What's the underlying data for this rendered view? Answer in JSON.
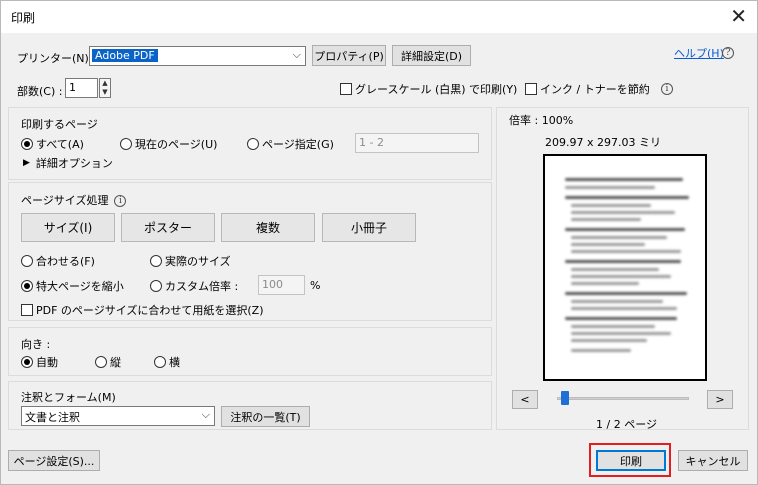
{
  "window": {
    "title": "印刷"
  },
  "printer": {
    "label": "プリンター(N) :",
    "selected": "Adobe PDF",
    "properties_button": "プロパティ(P)",
    "advanced_button": "詳細設定(D)",
    "help_link": "ヘルプ(H)"
  },
  "copies": {
    "label": "部数(C) :",
    "value": "1"
  },
  "options": {
    "grayscale": "グレースケール (白黒) で印刷(Y)",
    "save_ink": "インク / トナーを節約"
  },
  "pages_section": {
    "heading": "印刷するページ",
    "all": "すべて(A)",
    "current": "現在のページ(U)",
    "range": "ページ指定(G)",
    "range_value": "1 - 2",
    "more_options": "詳細オプション"
  },
  "page_sizing": {
    "heading": "ページサイズ処理",
    "tabs": [
      "サイズ(I)",
      "ポスター",
      "複数",
      "小冊子"
    ],
    "fit": "合わせる(F)",
    "actual": "実際のサイズ",
    "shrink": "特大ページを縮小",
    "custom": "カスタム倍率 :",
    "custom_value": "100",
    "percent": "%",
    "paper_by_pdf": "PDF のページサイズに合わせて用紙を選択(Z)"
  },
  "orientation": {
    "heading": "向き :",
    "auto": "自動",
    "portrait": "縦",
    "landscape": "横"
  },
  "comments": {
    "heading": "注釈とフォーム(M)",
    "selected": "文書と注釈",
    "summarize_button": "注釈の一覧(T)"
  },
  "preview": {
    "scale": "倍率 : 100%",
    "size": "209.97 x 297.03 ミリ",
    "prev": "<",
    "next": ">",
    "page_indicator": "1 / 2 ページ",
    "slider_position": 0.03
  },
  "footer": {
    "page_setup_button": "ページ設定(S)...",
    "print_button": "印刷",
    "cancel_button": "キャンセル"
  },
  "colors": {
    "accent": "#0a64c8",
    "highlight": "#e41e1e"
  }
}
